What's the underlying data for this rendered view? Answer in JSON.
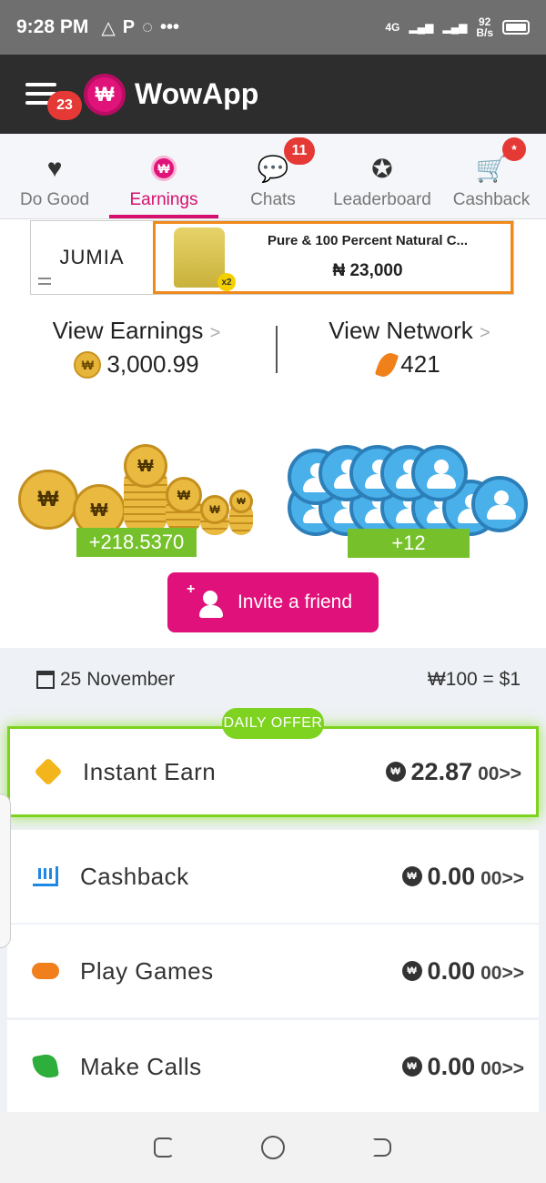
{
  "status_bar": {
    "time": "9:28 PM",
    "net_speed_value": "92",
    "net_speed_unit": "B/s",
    "network": "4G"
  },
  "app_bar": {
    "title": "WowApp",
    "menu_badge": "23",
    "logo_glyph": "₩"
  },
  "tabs": [
    {
      "label": "Do Good",
      "icon": "heart-hands-icon",
      "active": false
    },
    {
      "label": "Earnings",
      "icon": "wowcoin-icon",
      "active": true
    },
    {
      "label": "Chats",
      "icon": "chat-bubbles-icon",
      "badge": "11"
    },
    {
      "label": "Leaderboard",
      "icon": "medal-icon"
    },
    {
      "label": "Cashback",
      "icon": "cart-icon",
      "badge": "*"
    }
  ],
  "ad": {
    "brand": "JUMIA",
    "title": "Pure & 100 Percent Natural C...",
    "price": "₦ 23,000",
    "multiplier": "x2"
  },
  "summary": {
    "earnings_title": "View Earnings",
    "earnings_value": "3,000.99",
    "network_title": "View Network",
    "network_value": "421",
    "chevron": ">"
  },
  "illustrations": {
    "coins_gain": "+218.5370",
    "people_gain": "+12",
    "coin_glyph": "₩"
  },
  "invite": {
    "label": "Invite a friend",
    "plus": "+"
  },
  "date_row": {
    "date": "25 November",
    "rate": "₩100 = $1"
  },
  "offer_badge": "DAILY OFFER",
  "cards": [
    {
      "label": "Instant Earn",
      "amount": "22.87",
      "sub": "00>>",
      "icon": "tag-icon"
    },
    {
      "label": "Cashback",
      "amount": "0.00",
      "sub": "00>>",
      "icon": "cart-icon"
    },
    {
      "label": "Play Games",
      "amount": "0.00",
      "sub": "00>>",
      "icon": "gamepad-icon"
    },
    {
      "label": "Make Calls",
      "amount": "0.00",
      "sub": "00>>",
      "icon": "phone-icon"
    }
  ],
  "colors": {
    "brand": "#e0117a",
    "accent_green": "#76c12b",
    "app_bar": "#2d2d2d"
  }
}
